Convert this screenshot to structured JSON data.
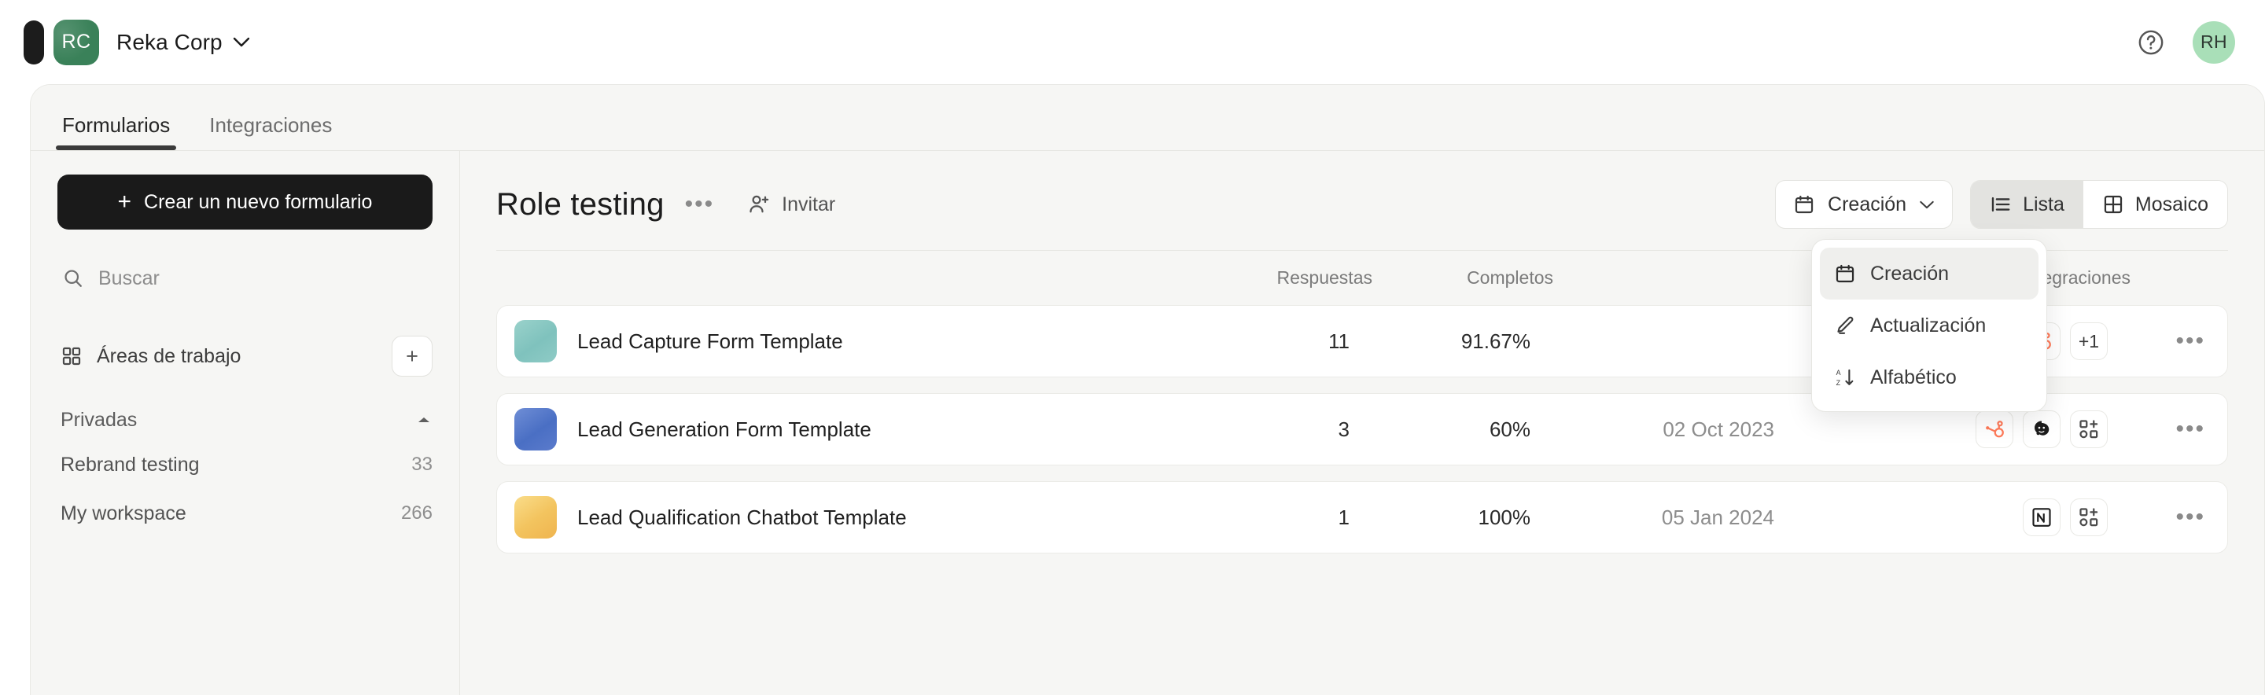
{
  "topbar": {
    "logo_icon": "pill-logo-icon",
    "org_initials": "RC",
    "org_name": "Reka Corp",
    "org_chevron_icon": "chevron-down-icon",
    "help_icon": "help-circle-icon",
    "user_initials": "RH"
  },
  "tabs": [
    {
      "label": "Formularios",
      "active": true
    },
    {
      "label": "Integraciones",
      "active": false
    }
  ],
  "sidebar": {
    "create_button": {
      "label": "Crear un nuevo formulario",
      "icon": "plus-icon"
    },
    "search": {
      "placeholder": "Buscar",
      "icon": "search-icon"
    },
    "workspaces_section": {
      "label": "Áreas de trabajo",
      "icon": "grid-icon",
      "add_icon": "plus-icon"
    },
    "group": {
      "label": "Privadas",
      "collapse_icon": "caret-up-icon"
    },
    "items": [
      {
        "label": "Rebrand testing",
        "count": "33"
      },
      {
        "label": "My workspace",
        "count": "266"
      }
    ]
  },
  "main": {
    "page_title": "Role testing",
    "title_more_icon": "ellipsis-icon",
    "invite": {
      "label": "Invitar",
      "icon": "person-plus-icon"
    },
    "sort_button": {
      "label": "Creación",
      "icon": "calendar-icon",
      "chevron_icon": "chevron-down-icon"
    },
    "view_toggle": [
      {
        "label": "Lista",
        "icon": "list-icon",
        "active": true
      },
      {
        "label": "Mosaico",
        "icon": "grid-view-icon",
        "active": false
      }
    ],
    "sort_menu": {
      "items": [
        {
          "label": "Creación",
          "icon": "calendar-icon",
          "active": true
        },
        {
          "label": "Actualización",
          "icon": "pencil-icon",
          "active": false
        },
        {
          "label": "Alfabético",
          "icon": "sort-az-icon",
          "active": false
        }
      ]
    },
    "table": {
      "columns": {
        "name": "",
        "responses": "Respuestas",
        "completed": "Completos",
        "date": "",
        "integrations": "Integraciones",
        "actions": ""
      },
      "rows": [
        {
          "thumb_color": "#8cc9c4",
          "name": "Lead Capture Form Template",
          "responses": "11",
          "completed": "91.67%",
          "date": "",
          "integrations": [
            "calendly-icon",
            "google-analytics-icon",
            "hubspot-icon"
          ],
          "extra_badge": "+1",
          "more_icon": "ellipsis-icon"
        },
        {
          "thumb_color": "#5275c8",
          "name": "Lead Generation Form Template",
          "responses": "3",
          "completed": "60%",
          "date": "02 Oct 2023",
          "integrations": [
            "hubspot-icon",
            "mailchimp-icon",
            "add-app-icon"
          ],
          "extra_badge": "",
          "more_icon": "ellipsis-icon"
        },
        {
          "thumb_color": "#f5cf6a",
          "name": "Lead Qualification Chatbot Template",
          "responses": "1",
          "completed": "100%",
          "date": "05 Jan 2024",
          "integrations": [
            "notion-icon",
            "add-app-icon"
          ],
          "extra_badge": "",
          "more_icon": "ellipsis-icon"
        }
      ]
    }
  },
  "colors": {
    "dark": "#1a1a1a",
    "panel_bg": "#f6f6f4",
    "card_bg": "#ffffff",
    "org_green": "#3a8159",
    "user_green": "#a9dfb8",
    "hubspot_orange": "#ff7a59",
    "calendly_blue": "#006bff"
  }
}
